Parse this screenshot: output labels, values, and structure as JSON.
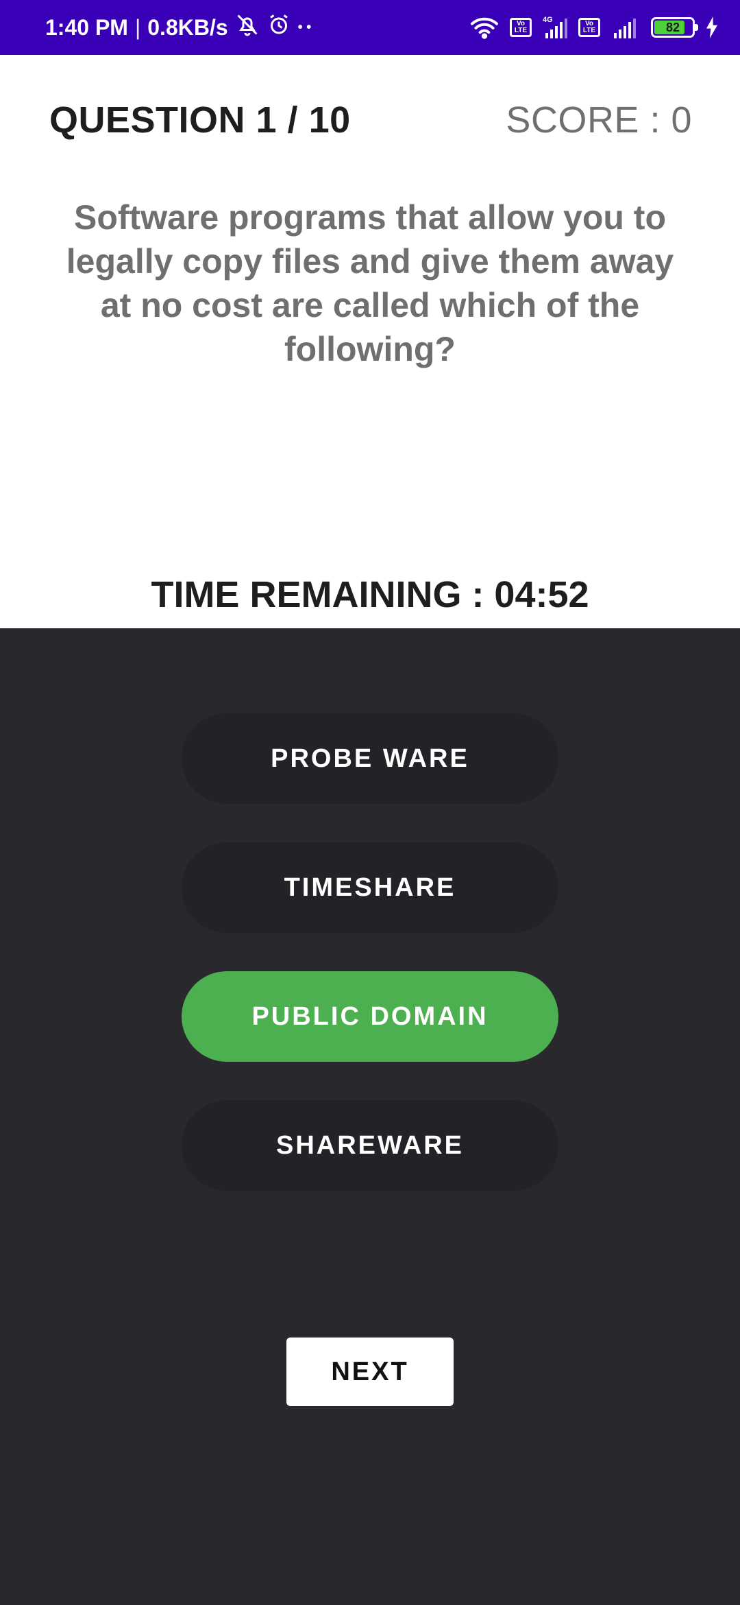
{
  "status_bar": {
    "time": "1:40 PM",
    "separator": "|",
    "network_speed": "0.8KB/s",
    "mute_icon": "bell-off-icon",
    "alarm_icon": "alarm-clock-icon",
    "dots": "• •",
    "wifi_icon": "wifi-icon",
    "volte_label": "Vo LTE",
    "network_type": "4G",
    "signal_icon": "cellular-signal-icon",
    "battery_level": "82",
    "charging_icon": "lightning-icon",
    "color": "#3a00b8"
  },
  "header": {
    "question_counter": "QUESTION 1 / 10",
    "score": "SCORE : 0"
  },
  "question": {
    "text": "Software programs that allow you to legally copy files and give them away at no cost are called which of the following?"
  },
  "timer": {
    "text": "TIME REMAINING : 04:52"
  },
  "options": [
    {
      "label": "PROBE WARE",
      "selected": false
    },
    {
      "label": "TIMESHARE",
      "selected": false
    },
    {
      "label": "PUBLIC DOMAIN",
      "selected": true
    },
    {
      "label": "SHAREWARE",
      "selected": false
    }
  ],
  "next_button": {
    "label": "NEXT"
  },
  "colors": {
    "selected_option": "#4caf50",
    "panel_background": "#29282c",
    "option_background": "#232226"
  }
}
